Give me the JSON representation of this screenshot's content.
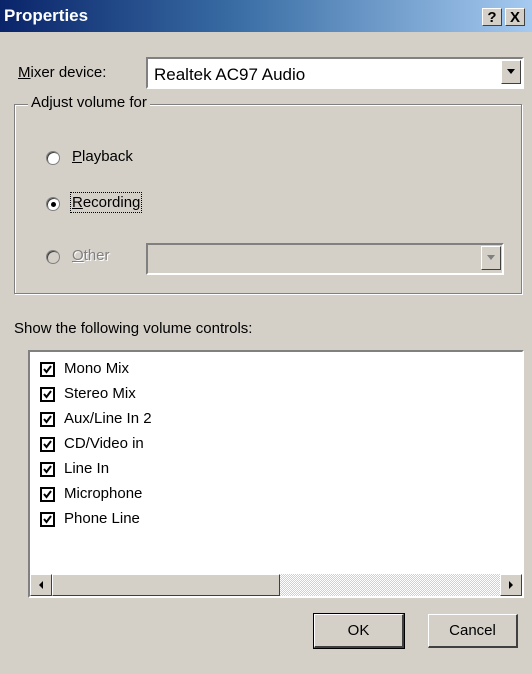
{
  "window": {
    "title": "Properties",
    "help_glyph": "?",
    "close_glyph": "X"
  },
  "mixer": {
    "label": "Mixer device:",
    "accesskey": "M",
    "label_rest": "ixer device:",
    "value": "Realtek AC97 Audio"
  },
  "adjust": {
    "legend": "Adjust volume for",
    "options": [
      {
        "label": "Playback",
        "accesskey": "P",
        "rest": "layback",
        "selected": false,
        "enabled": true
      },
      {
        "label": "Recording",
        "accesskey": "R",
        "rest": "ecording",
        "selected": true,
        "enabled": true
      },
      {
        "label": "Other",
        "accesskey": "O",
        "rest": "ther",
        "selected": false,
        "enabled": false
      }
    ],
    "other_value": ""
  },
  "controls": {
    "label": "Show the following volume controls:",
    "items": [
      {
        "label": "Mono Mix",
        "checked": true
      },
      {
        "label": "Stereo Mix",
        "checked": true
      },
      {
        "label": "Aux/Line In 2",
        "checked": true
      },
      {
        "label": "CD/Video in",
        "checked": true
      },
      {
        "label": "Line In",
        "checked": true
      },
      {
        "label": "Microphone",
        "checked": true
      },
      {
        "label": "Phone Line",
        "checked": true
      }
    ]
  },
  "buttons": {
    "ok": "OK",
    "cancel": "Cancel"
  },
  "icons": {
    "dropdown": "chevron-down-icon",
    "scroll_left": "arrow-left-icon",
    "scroll_right": "arrow-right-icon",
    "check": "check-icon"
  }
}
